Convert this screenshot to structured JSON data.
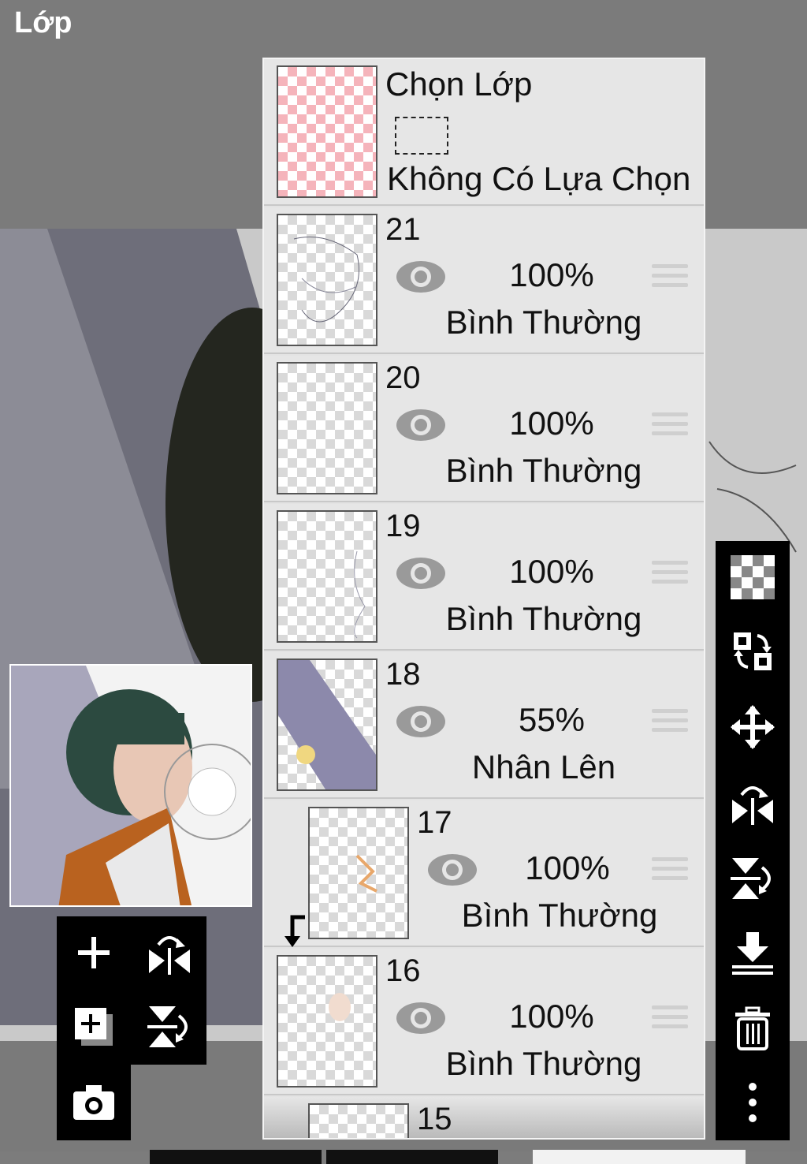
{
  "app": {
    "title": "Lớp"
  },
  "selection_layer": {
    "title": "Chọn Lớp",
    "status": "Không Có Lựa Chọn"
  },
  "layers": [
    {
      "number": "21",
      "opacity": "100%",
      "blend": "Bình Thường",
      "visible": true
    },
    {
      "number": "20",
      "opacity": "100%",
      "blend": "Bình Thường",
      "visible": true
    },
    {
      "number": "19",
      "opacity": "100%",
      "blend": "Bình Thường",
      "visible": true
    },
    {
      "number": "18",
      "opacity": "55%",
      "blend": "Nhân Lên",
      "visible": true
    },
    {
      "number": "17",
      "opacity": "100%",
      "blend": "Bình Thường",
      "visible": true,
      "clipped": true
    },
    {
      "number": "16",
      "opacity": "100%",
      "blend": "Bình Thường",
      "visible": true
    },
    {
      "number": "15",
      "clipped": true
    }
  ],
  "right_toolbar": [
    "transparency-icon",
    "swap-layer-icon",
    "move-icon",
    "flip-horizontal-icon",
    "flip-vertical-icon",
    "merge-down-icon",
    "trash-icon",
    "more-icon"
  ],
  "left_toolbar": [
    "add-layer-icon",
    "flip-horizontal-icon",
    "add-layer-copy-icon",
    "flip-vertical-icon",
    "camera-icon"
  ],
  "colors": {
    "panel": "#e6e6e6",
    "toolbar": "#000000",
    "pink_check": "#f5b4bb",
    "eye": "#9a9a9a"
  }
}
